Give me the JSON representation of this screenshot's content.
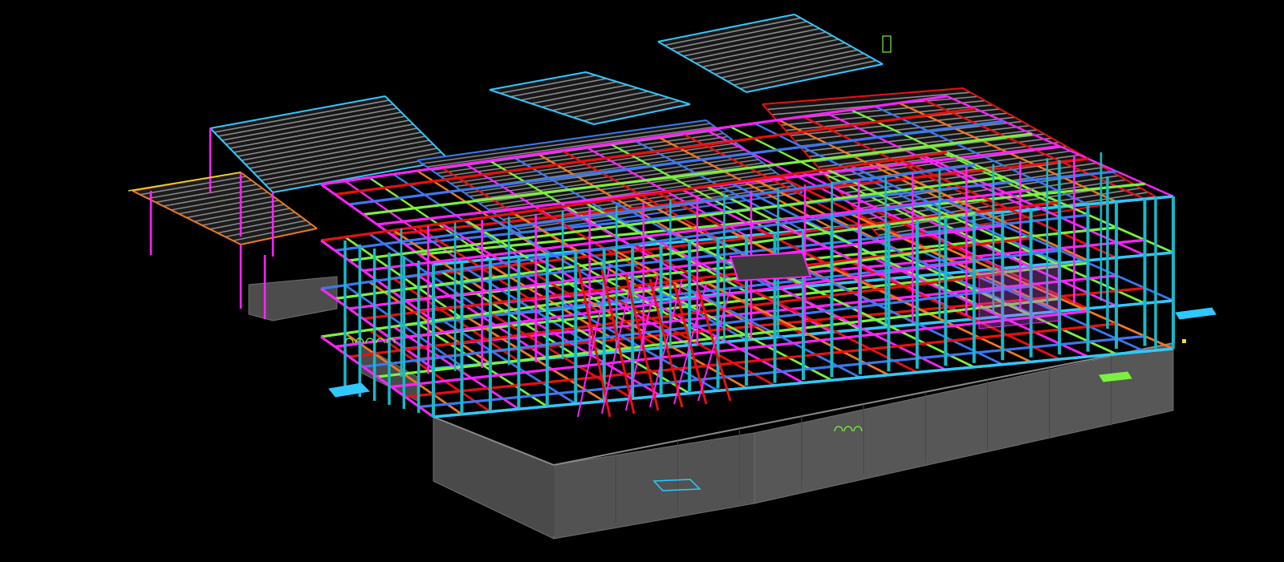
{
  "viewport": {
    "background": "#000000",
    "view_mode": "3d-wireframe-isometric"
  },
  "model": {
    "colors": {
      "column": "#19b8c8",
      "primary_beam": "#e81010",
      "secondary_beam": "#ff22ff",
      "tertiary_beam": "#3c78f0",
      "bracing": "#7cf040",
      "transfer_beam": "#f07820",
      "joist": "#8c8c8c",
      "slab": "#505050",
      "wall": "#4a4a4a",
      "wall_edge": "#6e6e6e",
      "misc": "#e8e020",
      "outline": "#30c8ff"
    }
  }
}
